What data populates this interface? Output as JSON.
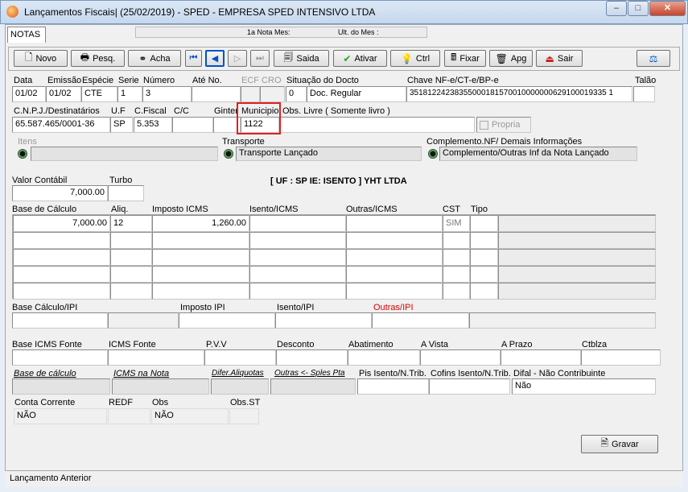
{
  "window": {
    "title": "Lançamentos Fiscais| (25/02/2019) - SPED - EMPRESA SPED INTENSIVO LTDA"
  },
  "tab": {
    "label": "NOTAS"
  },
  "info": {
    "primeira_nota": "1a Nota Mes:",
    "ult_mes": "Ult. do Mes :"
  },
  "toolbar": {
    "novo": "Novo",
    "pesq": "Pesq.",
    "acha": "Acha",
    "saida": "Saida",
    "ativar": "Ativar",
    "ctrl": "Ctrl",
    "fixar": "Fixar",
    "apg": "Apg",
    "sair": "Sair"
  },
  "doc": {
    "labels": {
      "data": "Data",
      "emissao": "Emissão",
      "especie": "Espécie",
      "serie": "Serie",
      "numero": "Número",
      "ate_no": "Até No.",
      "ecf_cro": "ECF CRO",
      "situacao": "Situação do Docto",
      "chave": "Chave NF-e/CT-e/BP-e",
      "talao": "Talão"
    },
    "values": {
      "data": "01/02",
      "emissao": "01/02",
      "especie": "CTE",
      "serie": "1",
      "numero": "3",
      "situacao_cod": "0",
      "situacao_desc": "Doc. Regular",
      "chave": "35181224238355000181570010000000629100019335 1"
    }
  },
  "dest": {
    "labels": {
      "cnpj": "C.N.P.J./Destinatários",
      "uf": "U.F",
      "cfiscal": "C.Fiscal",
      "cc": "C/C",
      "ginter": "Ginter",
      "municipio": "Municipio",
      "obs_livre": "Obs. Livre ( Somente livro )",
      "propria": "Propria"
    },
    "values": {
      "cnpj": "65.587.465/0001-36",
      "uf": "SP",
      "cfiscal": "5.353",
      "municipio": "1122"
    }
  },
  "status_row": {
    "itens": "Itens",
    "transporte": "Transporte",
    "transporte_val": "Transporte Lançado",
    "complemento": "Complemento.NF/ Demais Informações",
    "complemento_val": "Complemento/Outras Inf da Nota Lançado"
  },
  "valor": {
    "contabil_label": "Valor Contábil",
    "turbo_label": "Turbo",
    "contabil": "7,000.00",
    "uf_ie": "[ UF : SP IE: ISENTO ] YHT LTDA"
  },
  "grid": {
    "headers": [
      "Base de Cálculo",
      "Aliq.",
      "Imposto ICMS",
      "Isento/ICMS",
      "Outras/ICMS",
      "CST",
      "Tipo"
    ],
    "rows": [
      [
        "7,000.00",
        "12",
        "1,260.00",
        "",
        "",
        "SIM",
        ""
      ],
      [
        "",
        "",
        "",
        "",
        "",
        "",
        ""
      ],
      [
        "",
        "",
        "",
        "",
        "",
        "",
        ""
      ],
      [
        "",
        "",
        "",
        "",
        "",
        "",
        ""
      ],
      [
        "",
        "",
        "",
        "",
        "",
        "",
        ""
      ]
    ]
  },
  "ipi": {
    "base": "Base Cálculo/IPI",
    "imposto": "Imposto IPI",
    "isento": "Isento/IPI",
    "outras": "Outras/IPI"
  },
  "fonte": {
    "base": "Base ICMS Fonte",
    "icms": "ICMS Fonte",
    "pvv": "P.V.V",
    "desconto": "Desconto",
    "abatimento": "Abatimento",
    "avista": "A Vista",
    "aprazo": "A Prazo",
    "ctblza": "Ctblza"
  },
  "extra": {
    "base_calc": "Base de cálculo",
    "icms_nota": "ICMS na Nota",
    "difer": "Difer.Aliquotas",
    "outras_spl": "Outras <- Sples Pta",
    "pis": "Pis Isento/N.Trib.",
    "cofins": "Cofins Isento/N.Trib.",
    "difal": "Difal - Não Contribuinte",
    "difal_val": "Não"
  },
  "conta": {
    "cc_label": "Conta Corrente",
    "redf_label": "REDF",
    "obs_label": "Obs",
    "obsst_label": "Obs.ST",
    "cc_val": "NÃO",
    "obs_val": "NÃO"
  },
  "actions": {
    "gravar": "Gravar"
  },
  "statusbar": {
    "text": "Lançamento Anterior"
  },
  "colors": {
    "highlight": "#e02020",
    "red_label": "#dd0000"
  }
}
